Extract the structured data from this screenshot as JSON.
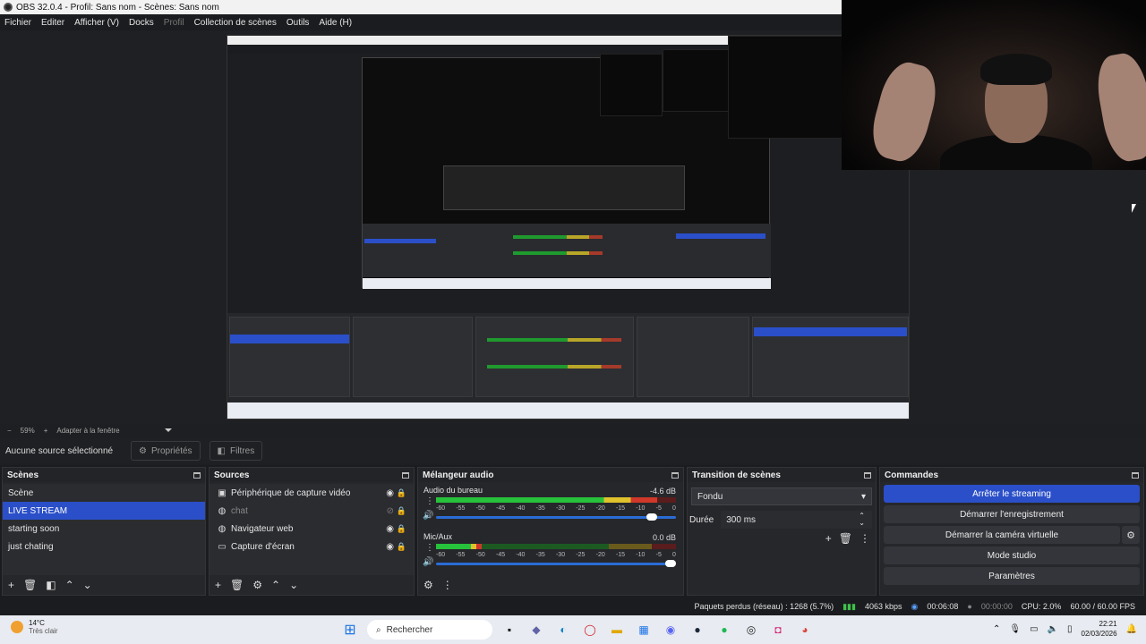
{
  "window": {
    "title": "OBS 32.0.4 - Profil: Sans nom - Scènes: Sans nom"
  },
  "menu": [
    "Fichier",
    "Editer",
    "Afficher (V)",
    "Docks",
    "Profil",
    "Collection de scènes",
    "Outils",
    "Aide (H)"
  ],
  "zoom": {
    "level": "59%",
    "fit_label": "Adapter à la fenêtre"
  },
  "context": {
    "no_source": "Aucune source sélectionné",
    "properties": "Propriétés",
    "filters": "Filtres"
  },
  "scenes": {
    "title": "Scènes",
    "items": [
      "Scène",
      "LIVE STREAM",
      "starting soon",
      "just chating"
    ],
    "active_index": 1
  },
  "sources": {
    "title": "Sources",
    "items": [
      {
        "label": "Périphérique de capture vidéo",
        "icon": "camera-icon",
        "visible": true
      },
      {
        "label": "chat",
        "icon": "globe-icon",
        "visible": false
      },
      {
        "label": "Navigateur web",
        "icon": "globe-icon",
        "visible": true
      },
      {
        "label": "Capture d'écran",
        "icon": "monitor-icon",
        "visible": true
      }
    ]
  },
  "mixer": {
    "title": "Mélangeur audio",
    "channels": [
      {
        "name": "Audio du bureau",
        "db": "-4.6 dB",
        "level": 0.92,
        "volume": 0.92
      },
      {
        "name": "Mic/Aux",
        "db": "0.0 dB",
        "level": 0.19,
        "volume": 1.0
      }
    ],
    "ticks": [
      "-60",
      "-55",
      "-50",
      "-45",
      "-40",
      "-35",
      "-30",
      "-25",
      "-20",
      "-15",
      "-10",
      "-5",
      "0"
    ]
  },
  "transitions": {
    "title": "Transition de scènes",
    "selected": "Fondu",
    "duration_label": "Durée",
    "duration_value": "300 ms"
  },
  "commands": {
    "title": "Commandes",
    "stop_stream": "Arrêter le streaming",
    "start_record": "Démarrer l'enregistrement",
    "virtual_cam": "Démarrer la caméra virtuelle",
    "studio_mode": "Mode studio",
    "settings": "Paramètres"
  },
  "status": {
    "dropped": "Paquets perdus (réseau) : 1268 (5.7%)",
    "bitrate": "4063 kbps",
    "stream_time": "00:06:08",
    "record_time": "00:00:00",
    "cpu": "CPU: 2.0%",
    "fps": "60.00 / 60.00 FPS"
  },
  "taskbar": {
    "temp": "14°C",
    "weather": "Très clair",
    "search": "Rechercher",
    "time": "22:21",
    "date": "02/03/2026"
  },
  "colors": {
    "accent": "#2a4fc8",
    "meter_green": "#27c23b",
    "meter_yellow": "#e0c22c",
    "meter_red": "#d0382a"
  }
}
